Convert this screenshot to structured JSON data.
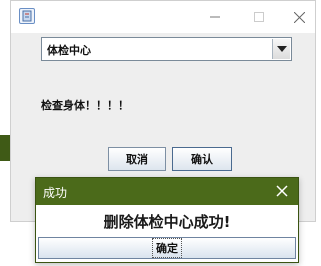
{
  "window": {
    "combo_value": "体检中心",
    "check_label": "检查身体！！！！",
    "cancel_label": "取消",
    "confirm_label": "确认",
    "icons": [
      "app-icon",
      "minimize-icon",
      "maximize-icon",
      "close-icon",
      "chevron-down-icon"
    ]
  },
  "dialog": {
    "title": "成功",
    "message": "删除体检中心成功!",
    "ok_label": "确定",
    "title_bar_color": "#4b6a1a"
  },
  "colors": {
    "accent_green": "#4b6a1a",
    "window_bg": "#eeeeee"
  }
}
